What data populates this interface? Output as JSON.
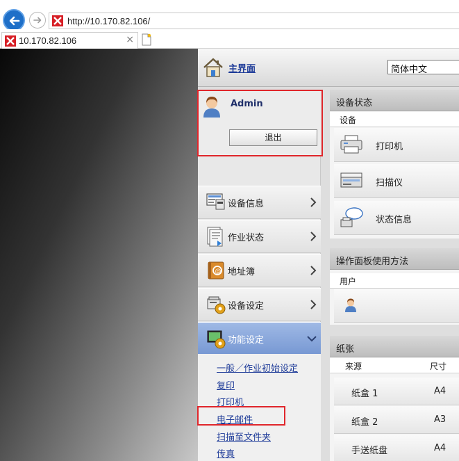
{
  "browser": {
    "url": "http://10.170.82.106/",
    "tab_title": "10.170.82.106",
    "tab_close": "×"
  },
  "header": {
    "home_label": "主界面",
    "language": "简体中文"
  },
  "user": {
    "name": "Admin",
    "logout_label": "退出"
  },
  "sidebar": {
    "items": [
      {
        "label": "设备信息",
        "icon": "device-info-icon"
      },
      {
        "label": "作业状态",
        "icon": "job-status-icon"
      },
      {
        "label": "地址簿",
        "icon": "address-book-icon"
      },
      {
        "label": "设备设定",
        "icon": "device-settings-icon"
      },
      {
        "label": "功能设定",
        "icon": "function-settings-icon",
        "expanded": true
      }
    ],
    "sub_items": [
      {
        "label": "一般／作业初始设定"
      },
      {
        "label": "复印"
      },
      {
        "label": "打印机"
      },
      {
        "label": "电子邮件"
      },
      {
        "label": "扫描至文件夹"
      },
      {
        "label": "传真"
      }
    ]
  },
  "device_status": {
    "title": "设备状态",
    "section": "设备",
    "devices": [
      {
        "label": "打印机",
        "icon": "printer-icon"
      },
      {
        "label": "扫描仪",
        "icon": "scanner-icon"
      },
      {
        "label": "状态信息",
        "icon": "status-info-icon"
      }
    ]
  },
  "panel_usage": {
    "title": "操作面板使用方法",
    "section": "用户"
  },
  "paper": {
    "title": "纸张",
    "col_source": "来源",
    "col_size": "尺寸",
    "rows": [
      {
        "source": "纸盒 1",
        "size": "A4"
      },
      {
        "source": "纸盒 2",
        "size": "A3"
      },
      {
        "source": "手送纸盘",
        "size": "A4"
      }
    ]
  },
  "colors": {
    "accent_red": "#e0262b",
    "link_blue": "#1f3c99",
    "active_menu": "#7798d3"
  }
}
